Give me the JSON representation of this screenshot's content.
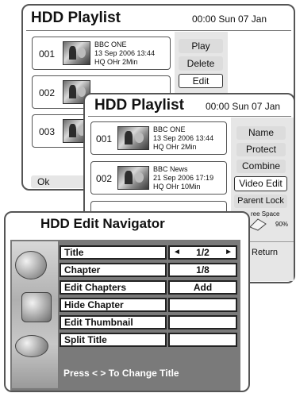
{
  "back_panel": {
    "title": "HDD Playlist",
    "datetime": "00:00 Sun 07 Jan",
    "items": [
      {
        "num": "001",
        "channel": "BBC ONE",
        "date": "13 Sep 2006 13:44",
        "quality": "HQ  OHr  2Min"
      },
      {
        "num": "002"
      },
      {
        "num": "003"
      }
    ],
    "buttons": {
      "play": "Play",
      "delete": "Delete",
      "edit": "Edit"
    },
    "ok_label": "Ok"
  },
  "front_panel": {
    "title": "HDD Playlist",
    "datetime": "00:00 Sun 07 Jan",
    "items": [
      {
        "num": "001",
        "channel": "BBC ONE",
        "date": "13 Sep 2006 13:44",
        "quality": "HQ  OHr  2Min"
      },
      {
        "num": "002",
        "channel": "BBC News",
        "date": "21 Sep 2006 17:19",
        "quality": "HQ  OHr  10Min"
      }
    ],
    "buttons": {
      "name": "Name",
      "protect": "Protect",
      "combine": "Combine",
      "video_edit": "Video Edit",
      "parent_lock": "Parent Lock"
    },
    "free_space_label": "ree Space",
    "free_space_value": "90%",
    "return_label": "Return"
  },
  "navigator": {
    "title": "HDD Edit Navigator",
    "rows": [
      {
        "label": "Title",
        "value": "1/2",
        "left_arrow": "◄",
        "right_arrow": "►"
      },
      {
        "label": "Chapter",
        "value": "1/8"
      },
      {
        "label": "Edit Chapters",
        "value": "Add"
      },
      {
        "label": "Hide Chapter",
        "value": ""
      },
      {
        "label": "Edit Thumbnail",
        "value": ""
      },
      {
        "label": "Split Title",
        "value": ""
      }
    ],
    "hint": "Press < > To Change Title"
  }
}
